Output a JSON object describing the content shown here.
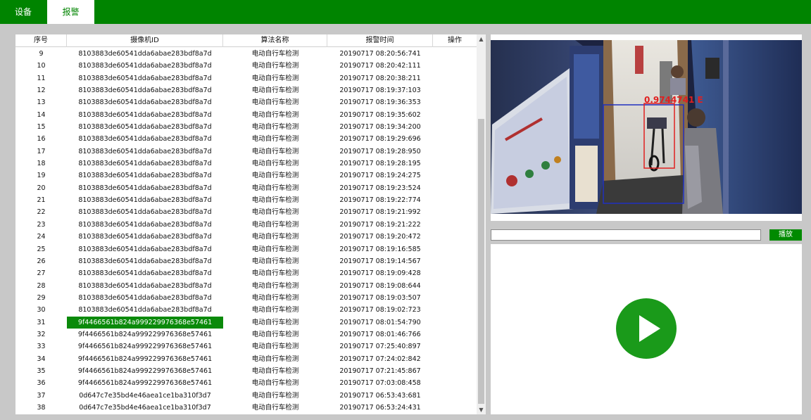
{
  "tabs": [
    {
      "label": "设备",
      "active": false
    },
    {
      "label": "报警",
      "active": true
    }
  ],
  "table": {
    "columns": [
      "序号",
      "摄像机ID",
      "算法名称",
      "报警时间",
      "操作"
    ],
    "rows": [
      {
        "no": "9",
        "camera_id": "8103883de60541dda6abae283bdf8a7d",
        "algorithm": "电动自行车检测",
        "time": "20190717 08:20:56:741"
      },
      {
        "no": "10",
        "camera_id": "8103883de60541dda6abae283bdf8a7d",
        "algorithm": "电动自行车检测",
        "time": "20190717 08:20:42:111"
      },
      {
        "no": "11",
        "camera_id": "8103883de60541dda6abae283bdf8a7d",
        "algorithm": "电动自行车检测",
        "time": "20190717 08:20:38:211"
      },
      {
        "no": "12",
        "camera_id": "8103883de60541dda6abae283bdf8a7d",
        "algorithm": "电动自行车检测",
        "time": "20190717 08:19:37:103"
      },
      {
        "no": "13",
        "camera_id": "8103883de60541dda6abae283bdf8a7d",
        "algorithm": "电动自行车检测",
        "time": "20190717 08:19:36:353"
      },
      {
        "no": "14",
        "camera_id": "8103883de60541dda6abae283bdf8a7d",
        "algorithm": "电动自行车检测",
        "time": "20190717 08:19:35:602"
      },
      {
        "no": "15",
        "camera_id": "8103883de60541dda6abae283bdf8a7d",
        "algorithm": "电动自行车检测",
        "time": "20190717 08:19:34:200"
      },
      {
        "no": "16",
        "camera_id": "8103883de60541dda6abae283bdf8a7d",
        "algorithm": "电动自行车检测",
        "time": "20190717 08:19:29:696"
      },
      {
        "no": "17",
        "camera_id": "8103883de60541dda6abae283bdf8a7d",
        "algorithm": "电动自行车检测",
        "time": "20190717 08:19:28:950"
      },
      {
        "no": "18",
        "camera_id": "8103883de60541dda6abae283bdf8a7d",
        "algorithm": "电动自行车检测",
        "time": "20190717 08:19:28:195"
      },
      {
        "no": "19",
        "camera_id": "8103883de60541dda6abae283bdf8a7d",
        "algorithm": "电动自行车检测",
        "time": "20190717 08:19:24:275"
      },
      {
        "no": "20",
        "camera_id": "8103883de60541dda6abae283bdf8a7d",
        "algorithm": "电动自行车检测",
        "time": "20190717 08:19:23:524"
      },
      {
        "no": "21",
        "camera_id": "8103883de60541dda6abae283bdf8a7d",
        "algorithm": "电动自行车检测",
        "time": "20190717 08:19:22:774"
      },
      {
        "no": "22",
        "camera_id": "8103883de60541dda6abae283bdf8a7d",
        "algorithm": "电动自行车检测",
        "time": "20190717 08:19:21:992"
      },
      {
        "no": "23",
        "camera_id": "8103883de60541dda6abae283bdf8a7d",
        "algorithm": "电动自行车检测",
        "time": "20190717 08:19:21:222"
      },
      {
        "no": "24",
        "camera_id": "8103883de60541dda6abae283bdf8a7d",
        "algorithm": "电动自行车检测",
        "time": "20190717 08:19:20:472"
      },
      {
        "no": "25",
        "camera_id": "8103883de60541dda6abae283bdf8a7d",
        "algorithm": "电动自行车检测",
        "time": "20190717 08:19:16:585"
      },
      {
        "no": "26",
        "camera_id": "8103883de60541dda6abae283bdf8a7d",
        "algorithm": "电动自行车检测",
        "time": "20190717 08:19:14:567"
      },
      {
        "no": "27",
        "camera_id": "8103883de60541dda6abae283bdf8a7d",
        "algorithm": "电动自行车检测",
        "time": "20190717 08:19:09:428"
      },
      {
        "no": "28",
        "camera_id": "8103883de60541dda6abae283bdf8a7d",
        "algorithm": "电动自行车检测",
        "time": "20190717 08:19:08:644"
      },
      {
        "no": "29",
        "camera_id": "8103883de60541dda6abae283bdf8a7d",
        "algorithm": "电动自行车检测",
        "time": "20190717 08:19:03:507"
      },
      {
        "no": "30",
        "camera_id": "8103883de60541dda6abae283bdf8a7d",
        "algorithm": "电动自行车检测",
        "time": "20190717 08:19:02:723"
      },
      {
        "no": "31",
        "camera_id": "9f4466561b824a999229976368e57461",
        "algorithm": "电动自行车检测",
        "time": "20190717 08:01:54:790",
        "selected": true
      },
      {
        "no": "32",
        "camera_id": "9f4466561b824a999229976368e57461",
        "algorithm": "电动自行车检测",
        "time": "20190717 08:01:46:766"
      },
      {
        "no": "33",
        "camera_id": "9f4466561b824a999229976368e57461",
        "algorithm": "电动自行车检测",
        "time": "20190717 07:25:40:897"
      },
      {
        "no": "34",
        "camera_id": "9f4466561b824a999229976368e57461",
        "algorithm": "电动自行车检测",
        "time": "20190717 07:24:02:842"
      },
      {
        "no": "35",
        "camera_id": "9f4466561b824a999229976368e57461",
        "algorithm": "电动自行车检测",
        "time": "20190717 07:21:45:867"
      },
      {
        "no": "36",
        "camera_id": "9f4466561b824a999229976368e57461",
        "algorithm": "电动自行车检测",
        "time": "20190717 07:03:08:458"
      },
      {
        "no": "37",
        "camera_id": "0d647c7e35bd4e46aea1ce1ba310f3d7",
        "algorithm": "电动自行车检测",
        "time": "20190717 06:53:43:681"
      },
      {
        "no": "38",
        "camera_id": "0d647c7e35bd4e46aea1ce1ba310f3d7",
        "algorithm": "电动自行车检测",
        "time": "20190717 06:53:24:431"
      }
    ]
  },
  "snapshot": {
    "confidence_label": "0.9744741  E",
    "detection_color": "#e02020",
    "region_color": "#2030c0"
  },
  "player": {
    "url_value": "",
    "play_label": "播放",
    "play_icon": "play-icon"
  },
  "colors": {
    "brand": "#008400",
    "selected_row": "#0a8a0a",
    "play_circle": "#1a9a1a"
  }
}
